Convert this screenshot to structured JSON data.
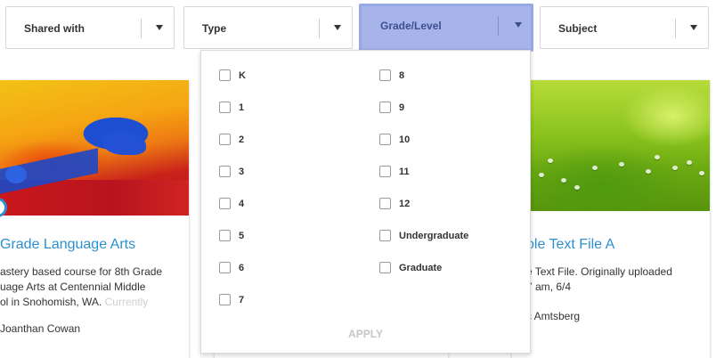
{
  "filters": [
    {
      "label": "Shared with"
    },
    {
      "label": "Type"
    },
    {
      "label": "Grade/Level"
    },
    {
      "label": "Subject"
    }
  ],
  "dropdown": {
    "column_a": [
      "K",
      "1",
      "2",
      "3",
      "4",
      "5",
      "6",
      "7"
    ],
    "column_b": [
      "8",
      "9",
      "10",
      "11",
      "12",
      "Undergraduate",
      "Graduate"
    ],
    "apply_label": "APPLY"
  },
  "cards": {
    "left": {
      "title": "Grade Language Arts",
      "desc_line1": "astery based course for 8th Grade",
      "desc_line2": "uage Arts at Centennial Middle",
      "desc_line3a": "ol in Snohomish, WA. ",
      "desc_line3b": "Currently",
      "author": "Joanthan Cowan"
    },
    "right": {
      "title": "ole Text File A",
      "desc_line1": "e Text File. Originally uploaded",
      "desc_line2": "7 am, 6/4",
      "author": "c Amtsberg"
    }
  },
  "colors": {
    "accent_link": "#2d8fd0",
    "active_filter": "#a6b4ea"
  }
}
